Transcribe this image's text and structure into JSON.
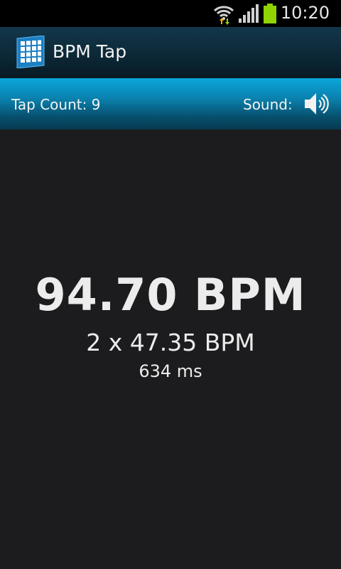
{
  "status_bar": {
    "time": "10:20",
    "icons": [
      "wifi-icon",
      "signal-icon",
      "battery-icon"
    ]
  },
  "action_bar": {
    "title": "BPM Tap",
    "icon": "grid-app-icon"
  },
  "info_bar": {
    "tap_count_label": "Tap Count: 9",
    "sound_label": "Sound:",
    "sound_icon": "speaker-icon"
  },
  "main": {
    "bpm": "94.70 BPM",
    "half_bpm": "2 x 47.35 BPM",
    "interval": "634 ms"
  },
  "colors": {
    "accent": "#0ba7dc",
    "action_bar": "#0d2a39",
    "background": "#1c1c1e",
    "battery": "#8fd400"
  }
}
